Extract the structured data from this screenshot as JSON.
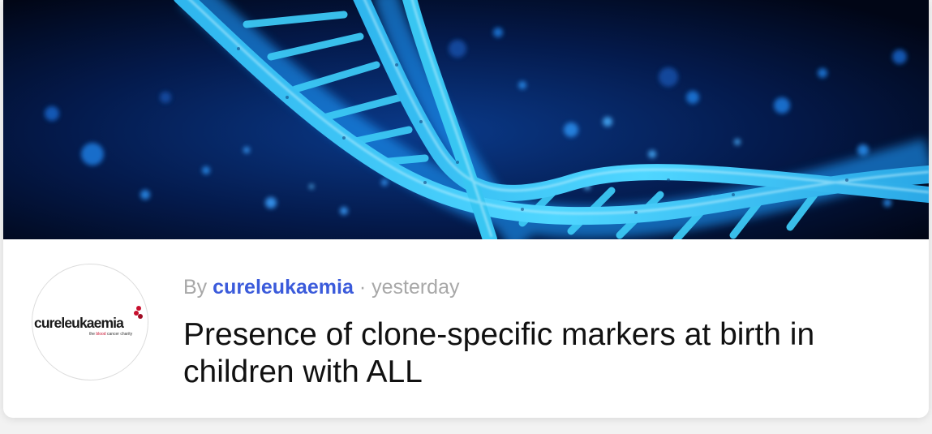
{
  "post": {
    "by_label": "By",
    "author": "cureleukaemia",
    "separator": "·",
    "time": "yesterday",
    "title": "Presence of clone-specific markers at birth in children with ALL"
  },
  "avatar": {
    "logo_text": "cureleukaemia",
    "tagline_pre": "the ",
    "tagline_red": "blood",
    "tagline_post": " cancer charity"
  },
  "hero": {
    "image": "dna-double-helix-blue",
    "colors": {
      "background": "#020a24",
      "strand": "#35c4f0",
      "glow": "#1e6fd9"
    }
  },
  "colors": {
    "author_link": "#3b5bdb",
    "meta_text": "#a8a8a8",
    "title_text": "#111111",
    "logo_red": "#c8102e"
  }
}
